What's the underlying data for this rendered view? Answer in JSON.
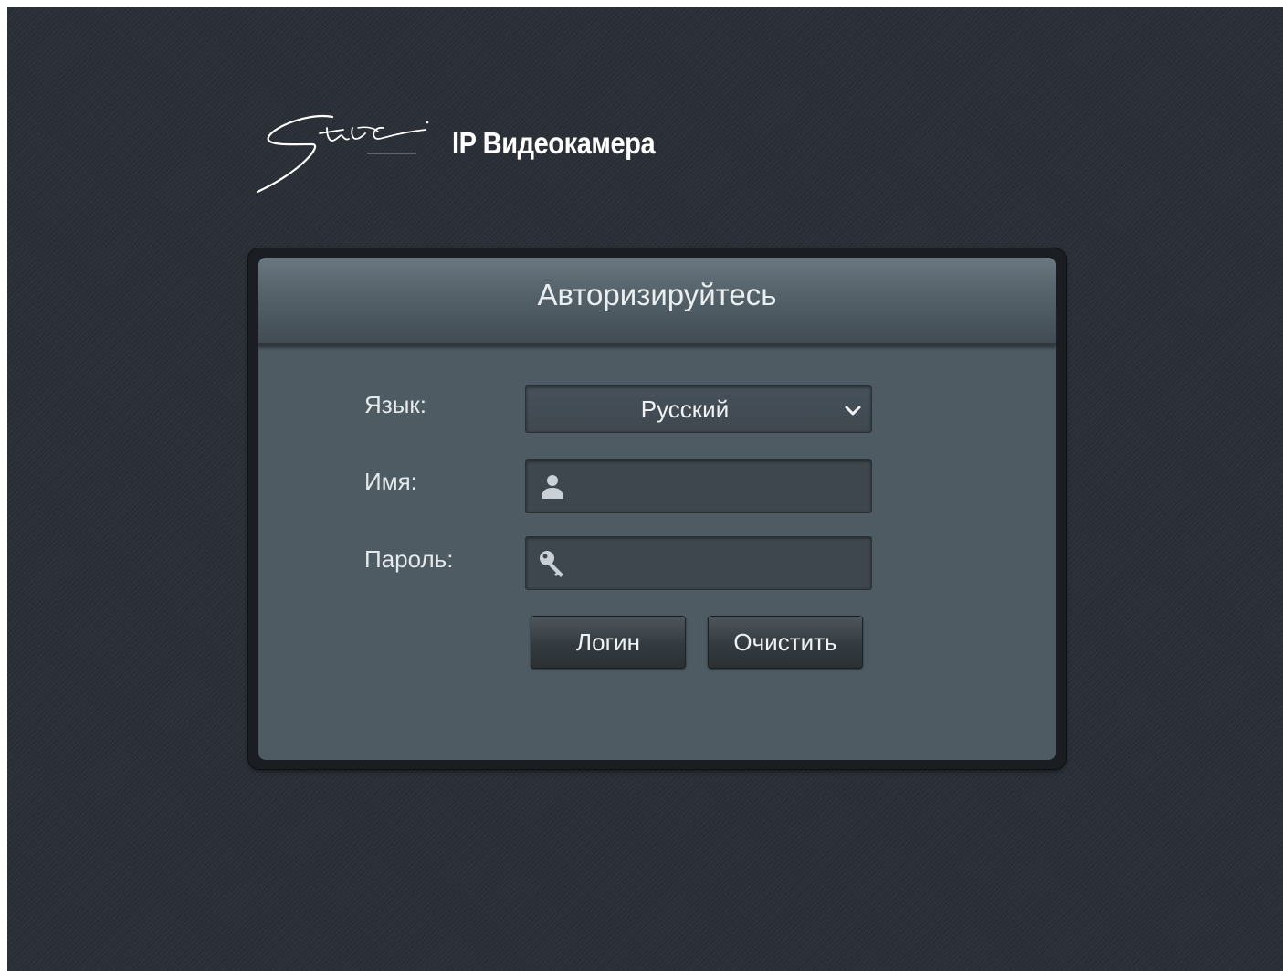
{
  "header": {
    "brand_logo": "stic-soft-logo",
    "brand_title": "IP Видеокамера"
  },
  "login": {
    "title": "Авторизируйтесь",
    "language_label": "Язык:",
    "language_value": "Русский",
    "username_label": "Имя:",
    "username_value": "",
    "password_label": "Пароль:",
    "password_value": "",
    "login_button": "Логин",
    "clear_button": "Очистить"
  },
  "icons": {
    "username": "user-icon",
    "password": "key-icon",
    "dropdown": "chevron-down-icon"
  },
  "colors": {
    "background": "#2b3038",
    "panel": "#4e5b63",
    "input": "#3e474d",
    "text": "#e9eef1"
  }
}
